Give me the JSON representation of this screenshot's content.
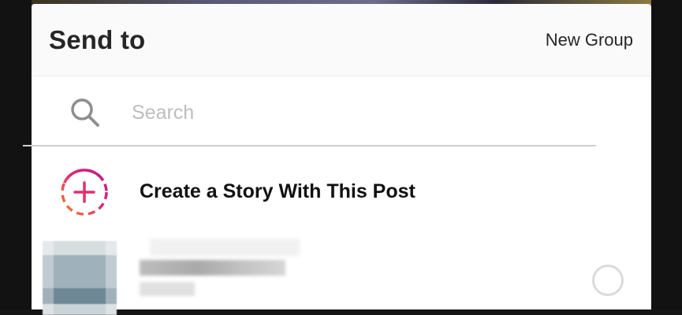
{
  "header": {
    "title": "Send to",
    "new_group_label": "New Group"
  },
  "search": {
    "placeholder": "Search",
    "value": "",
    "icon": "search-icon"
  },
  "story": {
    "label": "Create a Story With This Post",
    "icon": "add-story-icon",
    "gradient": [
      "#f58529",
      "#dd2a7b",
      "#bc1888"
    ]
  },
  "contacts": [
    {
      "name": "",
      "subtitle": "",
      "selected": false
    }
  ],
  "colors": {
    "header_bg": "#fafafa",
    "sheet_bg": "#ffffff",
    "text": "#262626",
    "placeholder": "#bdbdbd",
    "divider": "#cfcfcf",
    "radio_border": "#dbdbdb"
  }
}
